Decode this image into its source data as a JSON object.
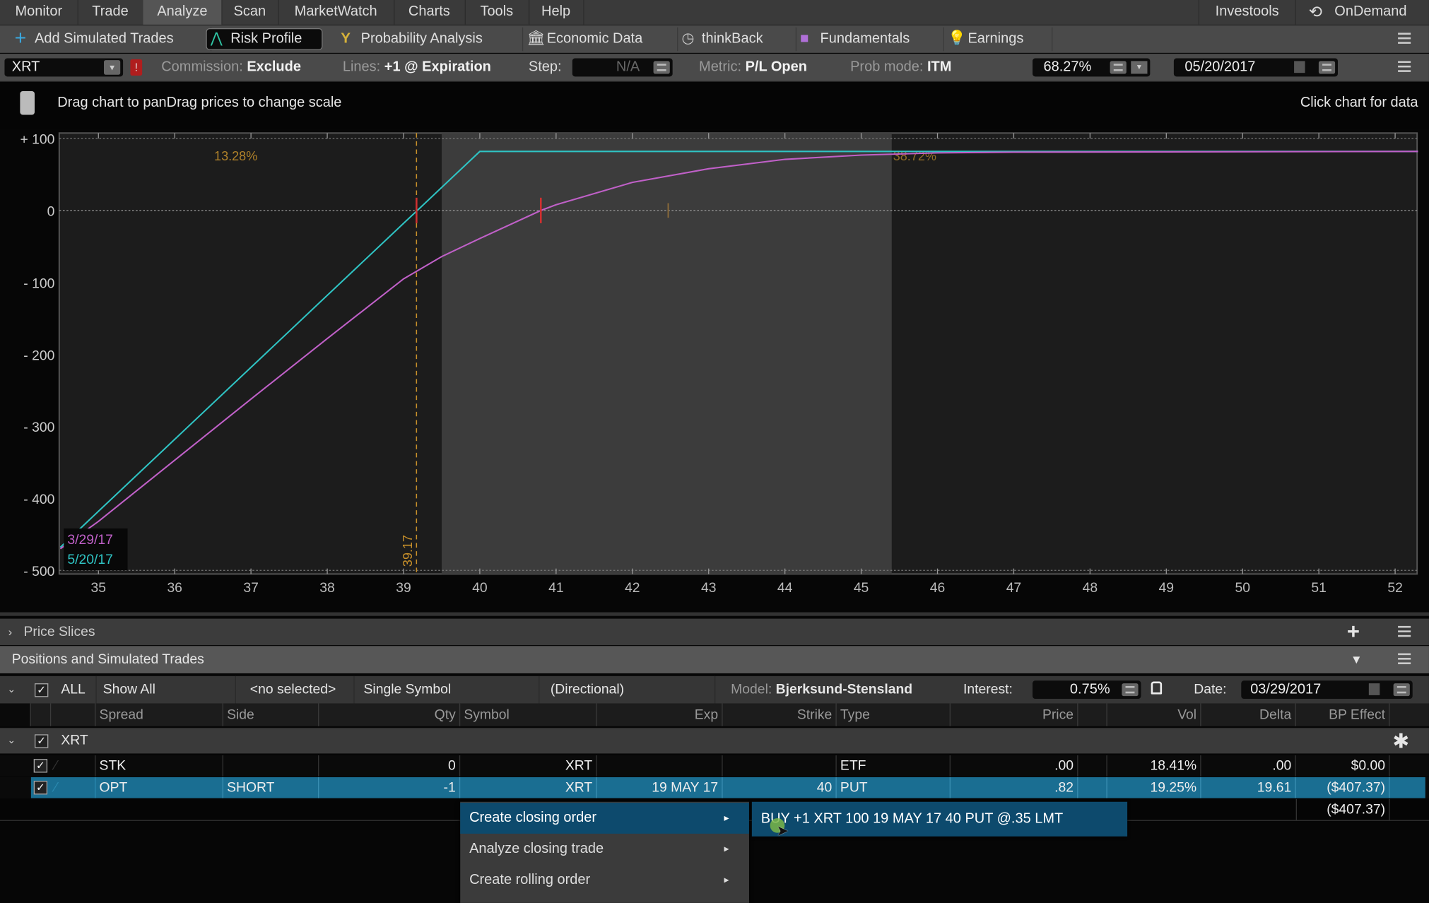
{
  "menubar": {
    "items": [
      "Monitor",
      "Trade",
      "Analyze",
      "Scan",
      "MarketWatch",
      "Charts",
      "Tools",
      "Help"
    ],
    "active": "Analyze",
    "right_items": [
      "Investools",
      "OnDemand"
    ]
  },
  "toolbar": {
    "items": [
      {
        "label": "Add Simulated Trades",
        "icon": "plus-icon"
      },
      {
        "label": "Risk Profile",
        "icon": "risk-profile-icon",
        "active": true
      },
      {
        "label": "Probability Analysis",
        "icon": "probability-icon"
      },
      {
        "label": "Economic Data",
        "icon": "building-icon"
      },
      {
        "label": "thinkBack",
        "icon": "clock-icon"
      },
      {
        "label": "Fundamentals",
        "icon": "cubes-icon"
      },
      {
        "label": "Earnings",
        "icon": "lightbulb-icon"
      }
    ]
  },
  "settings": {
    "symbol": "XRT",
    "alert_badge": "!",
    "commission_label": "Commission:",
    "commission_value": "Exclude",
    "lines_label": "Lines:",
    "lines_value": "+1 @ Expiration",
    "step_label": "Step:",
    "step_value": "N/A",
    "metric_label": "Metric:",
    "metric_value": "P/L Open",
    "probmode_label": "Prob mode:",
    "probmode_value": "ITM",
    "probability": "68.27%",
    "date": "05/20/2017"
  },
  "chart_header": {
    "hint": "Drag chart to panDrag prices to change scale",
    "click_hint": "Click chart for data"
  },
  "chart_data": {
    "type": "line",
    "xlim": [
      34.5,
      52.3
    ],
    "ylim": [
      -500,
      100
    ],
    "x_ticks": [
      "35",
      "36",
      "37",
      "38",
      "39",
      "40",
      "41",
      "42",
      "43",
      "44",
      "45",
      "46",
      "47",
      "48",
      "49",
      "50",
      "51",
      "52"
    ],
    "y_ticks": [
      {
        "v": 100,
        "label": "+ 100"
      },
      {
        "v": 0,
        "label": "0"
      },
      {
        "v": -100,
        "label": "- 100"
      },
      {
        "v": -200,
        "label": "- 200"
      },
      {
        "v": -300,
        "label": "- 300"
      },
      {
        "v": -400,
        "label": "- 400"
      },
      {
        "v": -500,
        "label": "- 500"
      }
    ],
    "grid": "horizontal dotted at 0 and top",
    "shaded_range": [
      39.5,
      45.4
    ],
    "current_price": 39.17,
    "current_price_label": "39.17",
    "prob_left_label": "13.28%",
    "prob_right_label": "38.72%",
    "series": [
      {
        "name": "5/20/17",
        "color": "#2fc4c4",
        "points": [
          [
            34.5,
            -468
          ],
          [
            35,
            -418
          ],
          [
            36,
            -318
          ],
          [
            37,
            -218
          ],
          [
            38,
            -118
          ],
          [
            39,
            -18
          ],
          [
            39.18,
            0
          ],
          [
            40,
            82
          ],
          [
            52.3,
            82
          ]
        ]
      },
      {
        "name": "3/29/17",
        "color": "#c060c8",
        "points": [
          [
            34.5,
            -470
          ],
          [
            35,
            -432
          ],
          [
            36,
            -347
          ],
          [
            37,
            -262
          ],
          [
            38,
            -178
          ],
          [
            39,
            -95
          ],
          [
            39.5,
            -64
          ],
          [
            40,
            -39
          ],
          [
            40.8,
            0
          ],
          [
            41,
            8
          ],
          [
            42,
            39
          ],
          [
            43,
            58
          ],
          [
            44,
            71
          ],
          [
            45,
            77
          ],
          [
            46,
            80
          ],
          [
            47,
            81
          ],
          [
            52.3,
            82
          ]
        ]
      }
    ]
  },
  "price_slices": {
    "label": "Price Slices"
  },
  "positions": {
    "title": "Positions and Simulated Trades",
    "filter": {
      "all": "ALL",
      "show": "Show All",
      "selected": "<no selected>",
      "symbol_mode": "Single Symbol",
      "directional": "(Directional)",
      "model_label": "Model:",
      "model_value": "Bjerksund-Stensland",
      "interest_label": "Interest:",
      "interest_value": "0.75%",
      "date_label": "Date:",
      "date_value": "03/29/2017"
    },
    "columns": [
      "Spread",
      "Side",
      "Qty",
      "Symbol",
      "Exp",
      "Strike",
      "Type",
      "Price",
      "Vol",
      "Delta",
      "BP Effect"
    ],
    "group": "XRT",
    "rows": [
      {
        "spread": "STK",
        "side": "",
        "qty": "0",
        "symbol": "XRT",
        "exp": "",
        "strike": "",
        "type": "ETF",
        "price": ".00",
        "vol": "18.41%",
        "delta": ".00",
        "bp": "$0.00"
      },
      {
        "spread": "OPT",
        "side": "SHORT",
        "qty": "-1",
        "symbol": "XRT",
        "exp": "19 MAY 17",
        "strike": "40",
        "type": "PUT",
        "price": ".82",
        "vol": "19.25%",
        "delta": "19.61",
        "bp": "($407.37)"
      }
    ],
    "total_bp": "($407.37)"
  },
  "context_menu": {
    "items": [
      "Create closing order",
      "Analyze closing trade",
      "Create rolling order"
    ],
    "submenu": "BUY +1 XRT 100 19 MAY 17 40 PUT @.35 LMT"
  },
  "colors": {
    "accent_selected": "#1a6e92",
    "menu_selected": "#0d4a6d",
    "expiration_line": "#2fc4c4",
    "today_line": "#c060c8",
    "price_marker": "#c8902a"
  }
}
